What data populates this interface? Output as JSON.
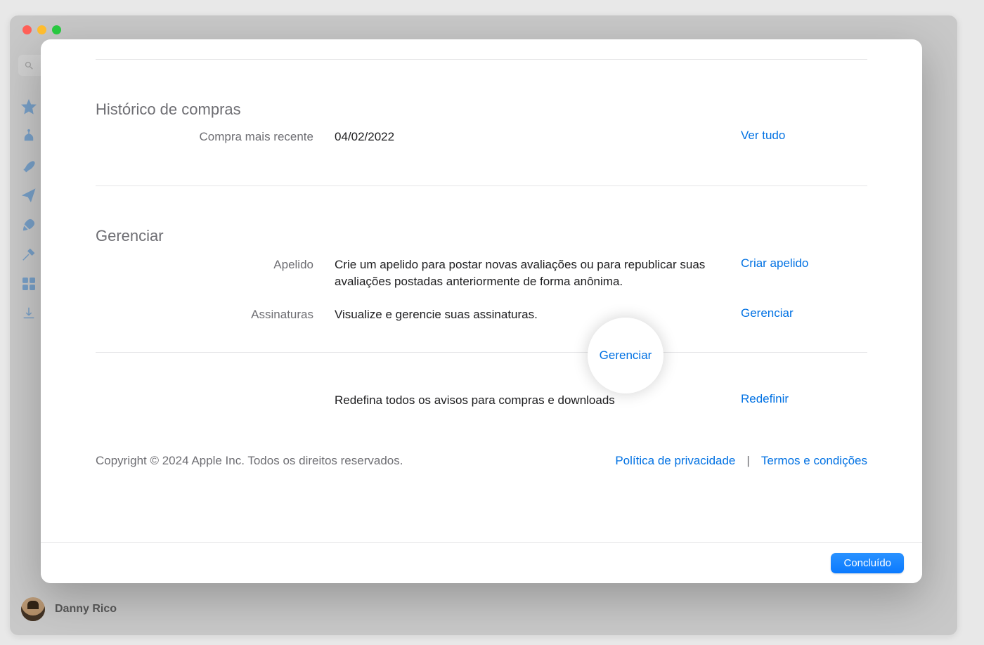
{
  "sidebar": {
    "search_placeholder": "",
    "user_name": "Danny Rico"
  },
  "modal": {
    "history": {
      "title": "Histórico de compras",
      "recent_label": "Compra mais recente",
      "recent_value": "04/02/2022",
      "see_all": "Ver tudo"
    },
    "manage": {
      "title": "Gerenciar",
      "nickname_label": "Apelido",
      "nickname_desc": "Crie um apelido para postar novas avaliações ou para republicar suas avaliações postadas anteriormente de forma anônima.",
      "nickname_action": "Criar apelido",
      "subscriptions_label": "Assinaturas",
      "subscriptions_desc": "Visualize e gerencie suas assinaturas.",
      "subscriptions_action": "Gerenciar"
    },
    "reset": {
      "desc": "Redefina todos os avisos para compras e downloads",
      "action": "Redefinir"
    },
    "footer": {
      "copyright": "Copyright © 2024 Apple Inc. Todos os direitos reservados.",
      "privacy": "Política de privacidade",
      "separator": "|",
      "terms": "Termos e condições"
    },
    "done_button": "Concluído"
  }
}
